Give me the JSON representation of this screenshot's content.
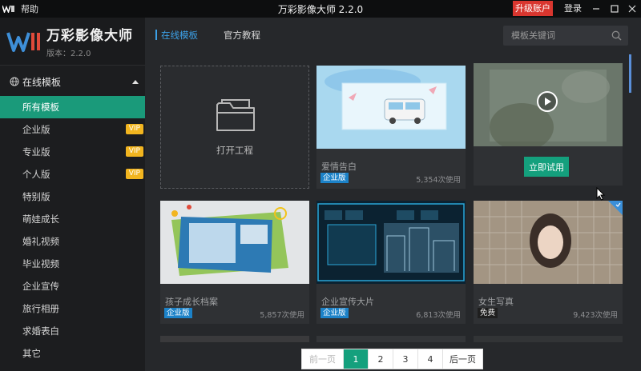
{
  "titlebar": {
    "help": "帮助",
    "title": "万彩影像大师 2.2.0",
    "upgrade": "升级账户",
    "login": "登录"
  },
  "brand": {
    "name": "万彩影像大师",
    "version": "版本：2.2.0"
  },
  "sidebar": {
    "category": "在线模板",
    "items": [
      {
        "label": "所有模板",
        "active": true,
        "vip": false
      },
      {
        "label": "企业版",
        "vip": true
      },
      {
        "label": "专业版",
        "vip": true
      },
      {
        "label": "个人版",
        "vip": true
      },
      {
        "label": "特别版",
        "vip": false
      },
      {
        "label": "萌娃成长",
        "vip": false
      },
      {
        "label": "婚礼视频",
        "vip": false
      },
      {
        "label": "毕业视频",
        "vip": false
      },
      {
        "label": "企业宣传",
        "vip": false
      },
      {
        "label": "旅行相册",
        "vip": false
      },
      {
        "label": "求婚表白",
        "vip": false
      },
      {
        "label": "其它",
        "vip": false
      }
    ],
    "vip_label": "VIP"
  },
  "tabs": {
    "online": "在线模板",
    "tutorial": "官方教程"
  },
  "search": {
    "placeholder": "模板关键词"
  },
  "open_project": "打开工程",
  "try_button": "立即试用",
  "cards": [
    {
      "title": "爱情告白",
      "badge": "企业版",
      "uses": "5,354次使用"
    },
    {
      "title": "孩子成长档案",
      "badge": "企业版",
      "uses": "5,857次使用"
    },
    {
      "title": "企业宣传大片",
      "badge": "企业版",
      "uses": "6,813次使用"
    },
    {
      "title": "女生写真",
      "badge": "免费",
      "uses": "9,423次使用"
    }
  ],
  "pager": {
    "prev": "前一页",
    "pages": [
      "1",
      "2",
      "3",
      "4"
    ],
    "current": "1",
    "next": "后一页"
  },
  "colors": {
    "accent": "#14a07d",
    "tab_active": "#3ca0e6",
    "vip": "#f2b51f",
    "upgrade": "#d9362f"
  }
}
